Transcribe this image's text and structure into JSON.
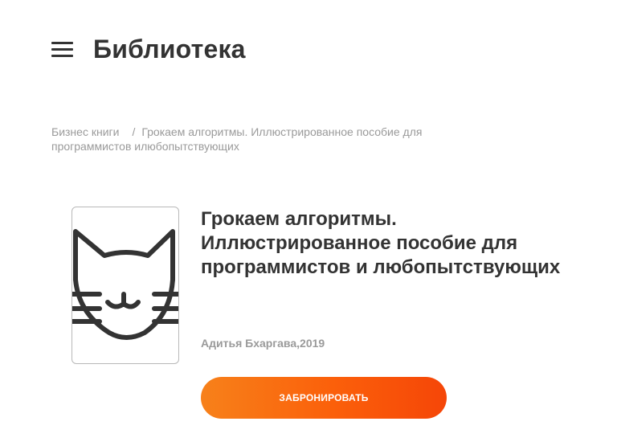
{
  "header": {
    "menu_icon": "hamburger-menu-icon",
    "title": "Библиотека"
  },
  "breadcrumb": {
    "category": "Бизнес книги",
    "separator": "/",
    "current": "Грокаем алгоритмы. Иллюстрированное пособие для программистов илюбопытствующих"
  },
  "book": {
    "cover_icon": "cat-face-icon",
    "title": "Грокаем алгоритмы. Иллюстрированное пособие для программистов и любопытствующих",
    "author": "Адитья Бхаргава",
    "year": "2019"
  },
  "actions": {
    "reserve_label": "ЗАБРОНИРОВАТЬ"
  },
  "colors": {
    "text": "#333333",
    "muted": "#9a9a9a",
    "accent_start": "#f7811a",
    "accent_end": "#f54608"
  }
}
